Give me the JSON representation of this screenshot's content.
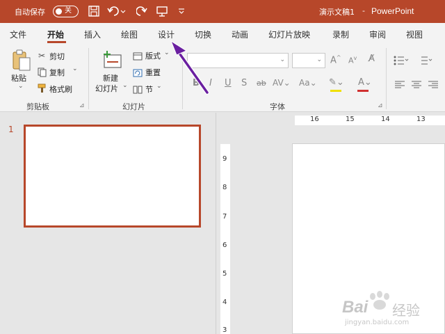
{
  "titlebar": {
    "autosave_label": "自动保存",
    "toggle_state": "关",
    "doc_title": "演示文稿1",
    "separator": "-",
    "app_name": "PowerPoint",
    "bg_color": "#b7472a"
  },
  "tabs": [
    {
      "label": "文件",
      "active": false
    },
    {
      "label": "开始",
      "active": true
    },
    {
      "label": "插入",
      "active": false
    },
    {
      "label": "绘图",
      "active": false
    },
    {
      "label": "设计",
      "active": false
    },
    {
      "label": "切换",
      "active": false
    },
    {
      "label": "动画",
      "active": false
    },
    {
      "label": "幻灯片放映",
      "active": false
    },
    {
      "label": "录制",
      "active": false
    },
    {
      "label": "审阅",
      "active": false
    },
    {
      "label": "视图",
      "active": false
    }
  ],
  "ribbon": {
    "clipboard": {
      "paste": "粘贴",
      "cut": "剪切",
      "copy": "复制",
      "format_painter": "格式刷",
      "label": "剪贴板"
    },
    "slides": {
      "new_slide_line1": "新建",
      "new_slide_line2": "幻灯片",
      "layout": "版式",
      "reset": "重置",
      "section": "节",
      "label": "幻灯片"
    },
    "font": {
      "label": "字体"
    }
  },
  "slide_panel": {
    "slide_number": "1",
    "accent_color": "#b7472a"
  },
  "rulers": {
    "horizontal": [
      "16",
      "15",
      "14",
      "13"
    ],
    "vertical": [
      "9",
      "8",
      "7",
      "6",
      "5",
      "4",
      "3"
    ]
  },
  "watermark": {
    "brand": "Bai",
    "brand_cn": "经验",
    "url": "jingyan.baidu.com"
  },
  "annotation": {
    "arrow_color": "#6a1fa0"
  }
}
